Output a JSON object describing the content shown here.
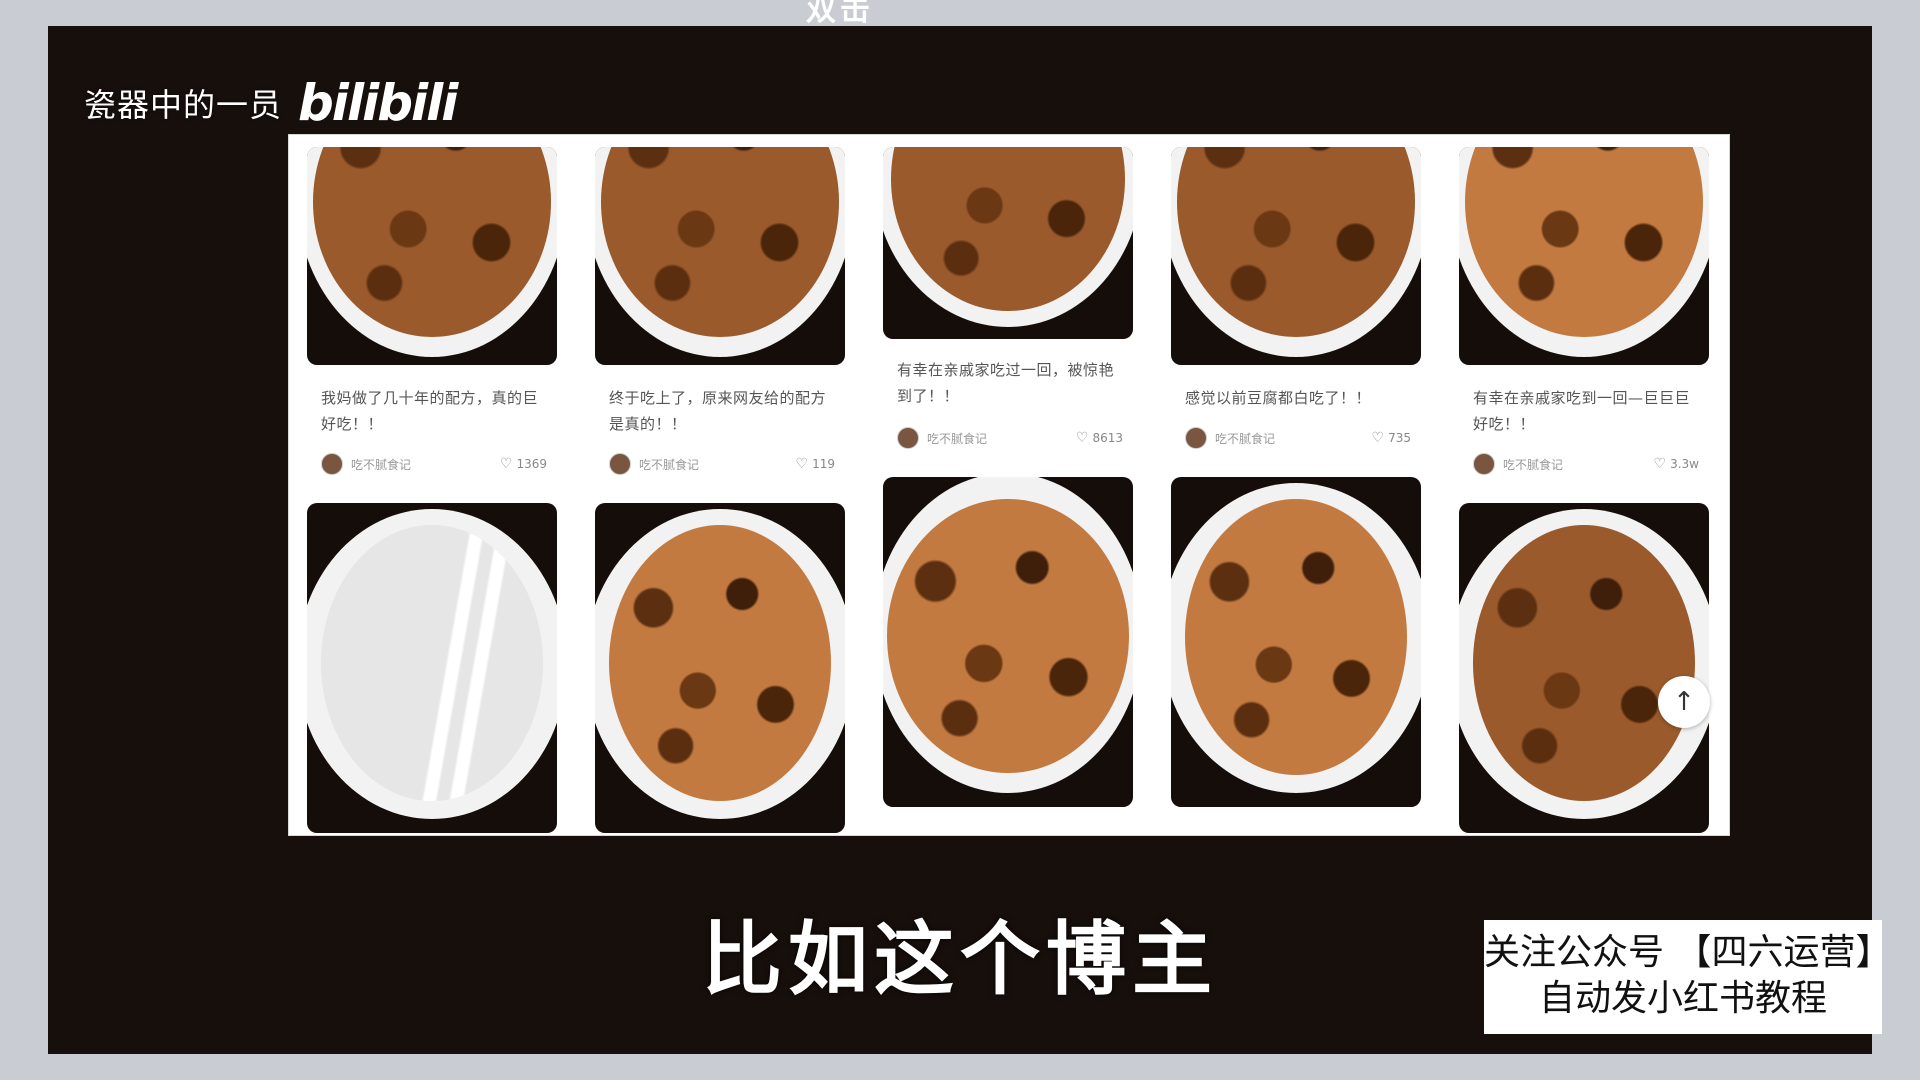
{
  "top_deco": "双击",
  "watermark": {
    "channel_text": "瓷器中的一员",
    "logo_text": "bilibili"
  },
  "feed": {
    "row1": [
      {
        "title": "我妈做了几十年的配方，真的巨好吃！！",
        "author": "吃不腻食记",
        "likes": "1369",
        "food": "dark"
      },
      {
        "title": "终于吃上了，原来网友给的配方是真的！！",
        "author": "吃不腻食记",
        "likes": "119",
        "food": "dark"
      },
      {
        "title": "有幸在亲戚家吃过一回，被惊艳到了！！",
        "author": "吃不腻食记",
        "likes": "8613",
        "food": "dark"
      },
      {
        "title": "感觉以前豆腐都白吃了！！",
        "author": "吃不腻食记",
        "likes": "735",
        "food": "dark"
      },
      {
        "title": "有幸在亲戚家吃到一回—巨巨巨好吃！！",
        "author": "吃不腻食记",
        "likes": "3.3w",
        "food": "light"
      }
    ],
    "row2": [
      {
        "food": "white"
      },
      {
        "food": "light"
      },
      {
        "food": "light"
      },
      {
        "food": "light"
      },
      {
        "food": "dark"
      }
    ],
    "back_to_top_icon": "arrow-up-icon",
    "back_to_top_glyph": "↑"
  },
  "subtitle": "比如这个博主",
  "promo": {
    "line1": "关注公众号 【四六运营】",
    "line2": "自动发小红书教程"
  },
  "colors": {
    "frame": "#170f0c",
    "outer": "#c9ccd3",
    "food": "#b8703a"
  }
}
